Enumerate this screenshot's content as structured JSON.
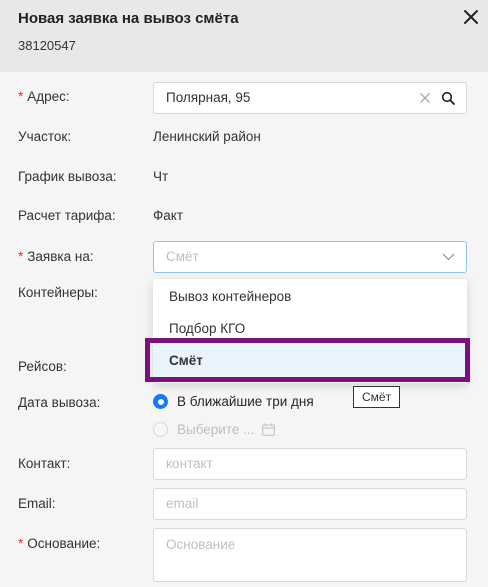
{
  "header": {
    "title": "Новая заявка на вывоз смёта",
    "subtitle": "38120547"
  },
  "form": {
    "address": {
      "label": "Адрес:",
      "value": "Полярная, 95",
      "required": true
    },
    "district": {
      "label": "Участок:",
      "value": "Ленинский район"
    },
    "schedule": {
      "label": "График вывоза:",
      "value": "Чт"
    },
    "tariff": {
      "label": "Расчет тарифа:",
      "value": "Факт"
    },
    "request_for": {
      "label": "Заявка на:",
      "placeholder": "Смёт",
      "required": true
    },
    "containers": {
      "label": "Контейнеры:"
    },
    "trips": {
      "label": "Рейсов:"
    },
    "date": {
      "label": "Дата вывоза:",
      "option_1": "В ближайшие три дня",
      "option_2": "Выберите ..."
    },
    "contact": {
      "label": "Контакт:",
      "placeholder": "контакт"
    },
    "email": {
      "label": "Email:",
      "placeholder": "email"
    },
    "basis": {
      "label": "Основание:",
      "placeholder": "Основание",
      "required": true
    }
  },
  "dropdown": {
    "items": [
      "Вывоз контейнеров",
      "Подбор КГО",
      "Смёт"
    ],
    "selected_index": 2
  },
  "tooltip": "Смёт",
  "colors": {
    "accent": "#1677ff",
    "highlight": "#7b0f7e",
    "required": "#e03131"
  }
}
